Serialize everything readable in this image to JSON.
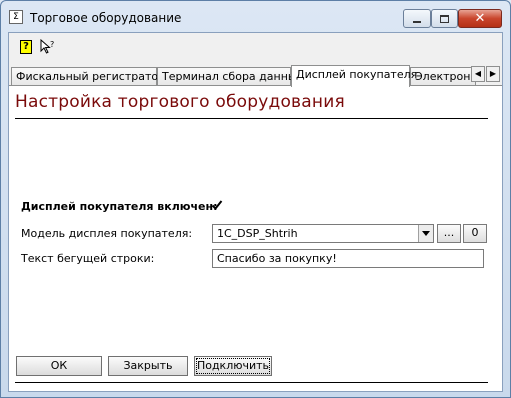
{
  "window": {
    "title": "Торговое оборудование",
    "app_icon_glyph": "Σ",
    "close_glyph": "✕"
  },
  "toolbar": {
    "help_glyph": "?",
    "whats_this_icon": "pointer-help-icon"
  },
  "tabs": [
    {
      "label": "Фискальный регистратор",
      "active": false
    },
    {
      "label": "Терминал сбора данных",
      "active": false
    },
    {
      "label": "Дисплей покупателя",
      "active": true
    },
    {
      "label": "Электрон",
      "active": false
    }
  ],
  "tab_scroll": {
    "left": "◀",
    "right": "▶"
  },
  "panel": {
    "heading": "Настройка торгового оборудования",
    "enabled_label": "Дисплей покупателя включен:",
    "enabled_checked": true,
    "model_label": "Модель дисплея покупателя:",
    "model_value": "1C_DSP_Shtrih",
    "browse_label": "...",
    "clear_label": "0",
    "ticker_label": "Текст бегущей строки:",
    "ticker_value": "Спасибо за покупку!"
  },
  "footer": {
    "ok_label": "ОК",
    "close_label": "Закрыть",
    "connect_label": "Подключить"
  },
  "colors": {
    "heading": "#7a0a0a",
    "close_button": "#c9452c",
    "help_icon_bg": "#ffff00"
  }
}
